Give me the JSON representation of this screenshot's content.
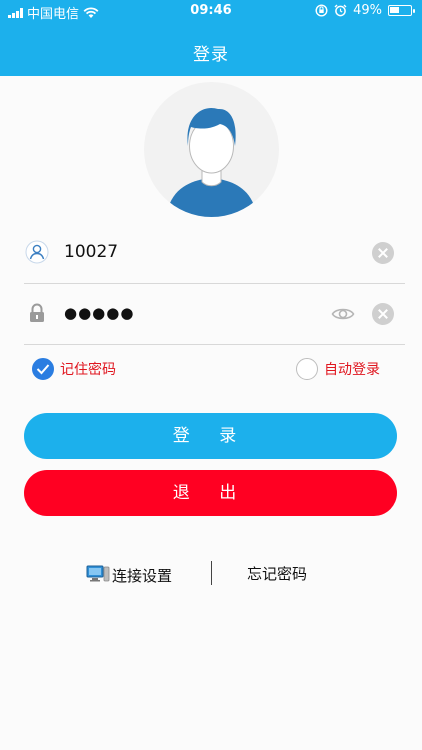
{
  "status_bar": {
    "carrier": "中国电信",
    "time": "09:46",
    "battery": "49%",
    "battery_level": 0.49
  },
  "header": {
    "title": "登录"
  },
  "form": {
    "username_value": "10027",
    "password_masked": "●●●●●"
  },
  "options": {
    "remember_label": "记住密码",
    "remember_checked": true,
    "auto_label": "自动登录",
    "auto_checked": false
  },
  "buttons": {
    "login_label": "登 录",
    "exit_label": "退 出"
  },
  "links": {
    "connection_label": "连接设置",
    "forgot_label": "忘记密码"
  },
  "colors": {
    "header": "#1cb0ec",
    "login": "#1cb0ec",
    "exit": "#ff0022",
    "option_text": "#e0161f",
    "checkbox": "#2a7de1"
  },
  "icons": [
    "signal-icon",
    "wifi-icon",
    "orientation-lock-icon",
    "alarm-icon",
    "battery-icon",
    "user-icon",
    "lock-icon",
    "eye-icon",
    "clear-icon",
    "checkmark-icon",
    "computer-icon"
  ]
}
